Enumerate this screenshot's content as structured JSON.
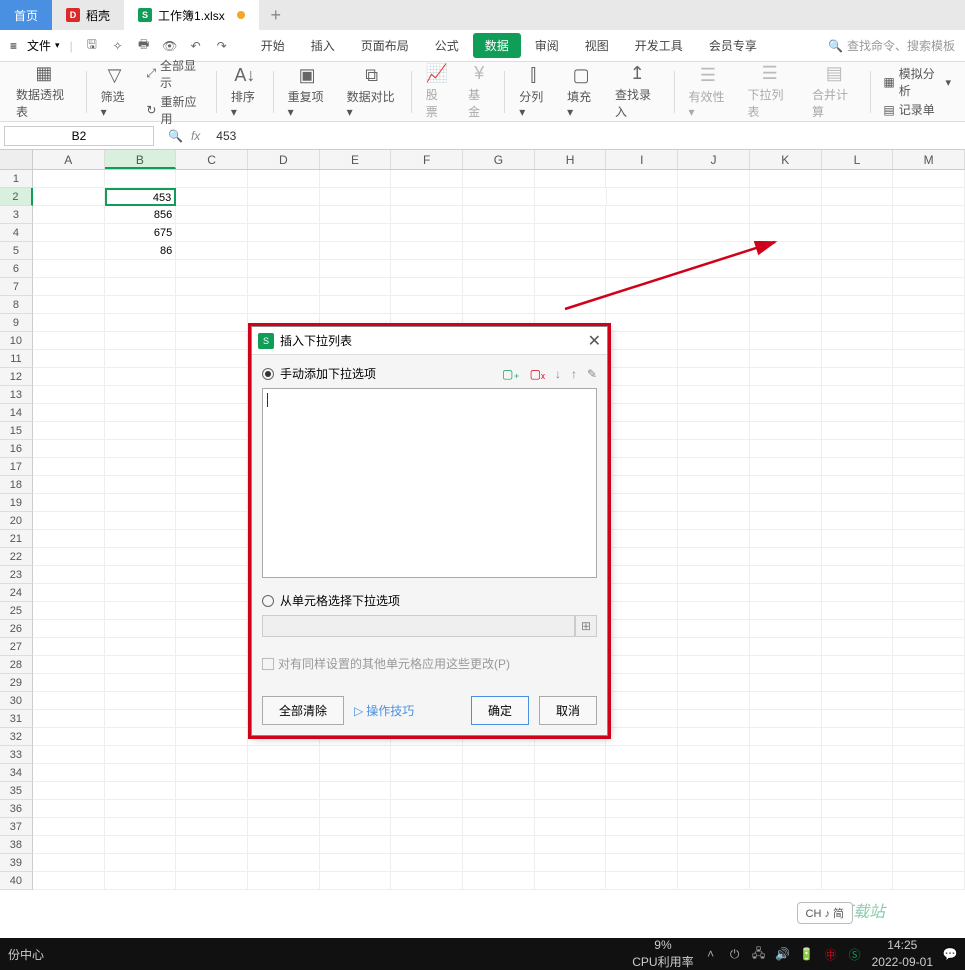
{
  "tabs": {
    "home": "首页",
    "doc1": "稻壳",
    "doc2": "工作簿1.xlsx",
    "plus": "+"
  },
  "menubar": {
    "file": "文件",
    "hamburger": "≡"
  },
  "menu": {
    "start": "开始",
    "insert": "插入",
    "page": "页面布局",
    "formula": "公式",
    "data": "数据",
    "review": "审阅",
    "view": "视图",
    "dev": "开发工具",
    "vip": "会员专享",
    "search": "查找命令、搜索模板"
  },
  "ribbon": {
    "pivot": "数据透视表",
    "filter": "筛选",
    "showall": "全部显示",
    "reapply": "重新应用",
    "sort": "排序",
    "dup": "重复项",
    "dcompare": "数据对比",
    "stock": "股票",
    "fund": "基金",
    "split": "分列",
    "fill": "填充",
    "lookinput": "查找录入",
    "valid": "有效性",
    "dropdown": "下拉列表",
    "merge": "合并计算",
    "whatif": "模拟分析",
    "record": "记录单"
  },
  "formula_bar": {
    "cell": "B2",
    "fx": "fx",
    "val": "453"
  },
  "columns": [
    "A",
    "B",
    "C",
    "D",
    "E",
    "F",
    "G",
    "H",
    "I",
    "J",
    "K",
    "L",
    "M"
  ],
  "data_cells": {
    "b2": "453",
    "b3": "856",
    "b4": "675",
    "b5": "86"
  },
  "rows": 40,
  "dialog": {
    "title": "插入下拉列表",
    "opt_manual": "手动添加下拉选项",
    "opt_range": "从单元格选择下拉选项",
    "apply_same": "对有同样设置的其他单元格应用这些更改(P)",
    "clear": "全部清除",
    "tips": "操作技巧",
    "ok": "确定",
    "cancel": "取消"
  },
  "ime": "CH ♪ 简",
  "taskbar": {
    "backup": "份中心",
    "cpu_label": "CPU利用率",
    "cpu_val": "9%",
    "time": "14:25",
    "date": "2022-09-01"
  },
  "watermark": "极光下载站"
}
